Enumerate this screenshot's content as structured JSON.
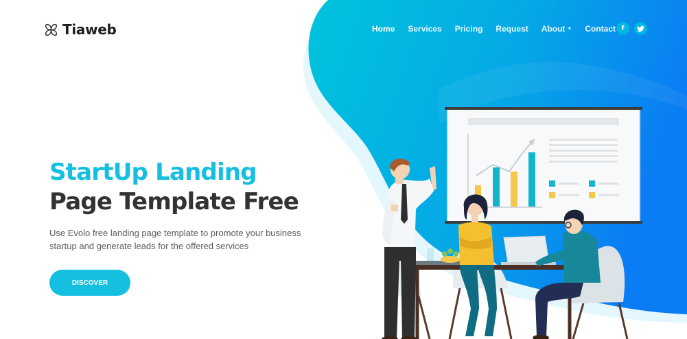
{
  "brand": {
    "name": "Tiaweb",
    "icon": "four-petal-logo-icon"
  },
  "nav": {
    "items": [
      {
        "label": "Home",
        "active": true
      },
      {
        "label": "Services",
        "active": false
      },
      {
        "label": "Pricing",
        "active": false
      },
      {
        "label": "Request",
        "active": false
      },
      {
        "label": "About",
        "active": false,
        "dropdown": true
      },
      {
        "label": "Contact",
        "active": false
      }
    ],
    "social": [
      {
        "icon": "facebook-icon",
        "glyph": "f"
      },
      {
        "icon": "twitter-icon",
        "glyph": "t"
      }
    ]
  },
  "hero": {
    "title_line1": "StartUp Landing",
    "title_line2": "Page Template Free",
    "description": "Use Evolo free landing page template to promote your business startup and generate leads for the offered services",
    "cta_label": "DISCOVER"
  },
  "colors": {
    "accent": "#14bfe0",
    "gradient_start": "#00c6db",
    "gradient_end": "#0a7cf4",
    "heading_dark": "#333333"
  },
  "illustration": {
    "icon": "team-meeting-presentation-illustration"
  }
}
